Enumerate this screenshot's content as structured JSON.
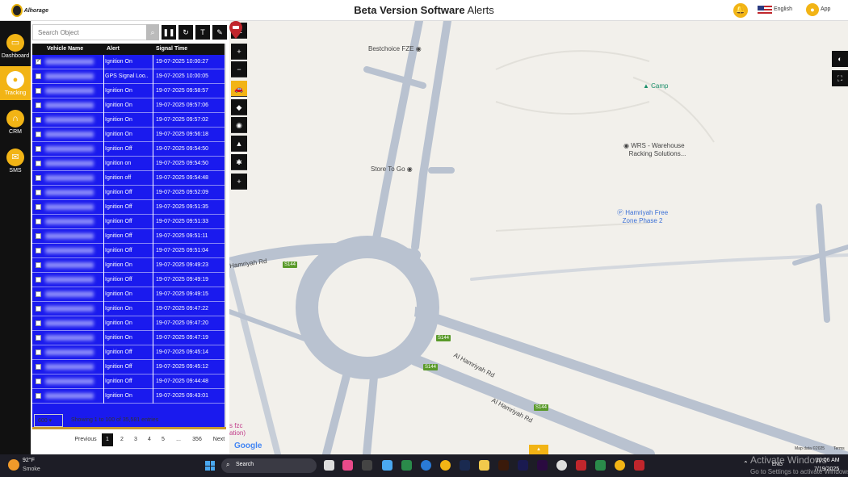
{
  "header": {
    "logo_text": "Alhorage",
    "title_bold": "Beta Version Software",
    "title_rest": " Alerts",
    "language": "English",
    "user": "App"
  },
  "nav": [
    {
      "label": "Dashboard",
      "icon": "monitor-icon"
    },
    {
      "label": "Tracking",
      "icon": "location-pin-icon"
    },
    {
      "label": "CRM",
      "icon": "headset-icon"
    },
    {
      "label": "SMS",
      "icon": "envelope-icon"
    }
  ],
  "panel": {
    "search_placeholder": "Search Object",
    "columns": [
      "Vehicle Name",
      "Alert",
      "Signal Time"
    ],
    "rows": [
      {
        "alert": "Ignition On",
        "time": "19-07-2025 10:00:27",
        "checked": true
      },
      {
        "alert": "GPS Signal Loo..",
        "time": "19-07-2025 10:00:05",
        "checked": false
      },
      {
        "alert": "Ignition On",
        "time": "19-07-2025 09:58:57",
        "checked": false
      },
      {
        "alert": "Ignition On",
        "time": "19-07-2025 09:57:06",
        "checked": false
      },
      {
        "alert": "Ignition On",
        "time": "19-07-2025 09:57:02",
        "checked": false
      },
      {
        "alert": "Ignition On",
        "time": "19-07-2025 09:56:18",
        "checked": false
      },
      {
        "alert": "Ignition Off",
        "time": "19-07-2025 09:54:50",
        "checked": false
      },
      {
        "alert": "Ignition on",
        "time": "19-07-2025 09:54:50",
        "checked": false
      },
      {
        "alert": "Ignition off",
        "time": "19-07-2025 09:54:48",
        "checked": false
      },
      {
        "alert": "Ignition Off",
        "time": "19-07-2025 09:52:09",
        "checked": false
      },
      {
        "alert": "Ignition Off",
        "time": "19-07-2025 09:51:35",
        "checked": false
      },
      {
        "alert": "Ignition Off",
        "time": "19-07-2025 09:51:33",
        "checked": false
      },
      {
        "alert": "Ignition Off",
        "time": "19-07-2025 09:51:11",
        "checked": false
      },
      {
        "alert": "Ignition Off",
        "time": "19-07-2025 09:51:04",
        "checked": false
      },
      {
        "alert": "Ignition On",
        "time": "19-07-2025 09:49:23",
        "checked": false
      },
      {
        "alert": "Ignition Off",
        "time": "19-07-2025 09:49:19",
        "checked": false
      },
      {
        "alert": "Ignition On",
        "time": "19-07-2025 09:49:15",
        "checked": false
      },
      {
        "alert": "Ignition On",
        "time": "19-07-2025 09:47:22",
        "checked": false
      },
      {
        "alert": "Ignition On",
        "time": "19-07-2025 09:47:20",
        "checked": false
      },
      {
        "alert": "Ignition On",
        "time": "19-07-2025 09:47:19",
        "checked": false
      },
      {
        "alert": "Ignition Off",
        "time": "19-07-2025 09:45:14",
        "checked": false
      },
      {
        "alert": "Ignition Off",
        "time": "19-07-2025 09:45:12",
        "checked": false
      },
      {
        "alert": "Ignition Off",
        "time": "19-07-2025 09:44:48",
        "checked": false
      },
      {
        "alert": "Ignition On",
        "time": "19-07-2025 09:43:01",
        "checked": false
      }
    ],
    "page_size": "600",
    "showing": "Showing 1 to 100 of 35,581 entries",
    "pagination": [
      "Previous",
      "1",
      "2",
      "3",
      "4",
      "5",
      "...",
      "356",
      "Next"
    ],
    "active_page": "1"
  },
  "map": {
    "pois": {
      "bestchoice": "Bestchoice FZE",
      "camp": "Camp",
      "wrs1": "WRS - Warehouse",
      "wrs2": "Racking Solutions...",
      "store": "Store To Go",
      "hamriyah1": "Hamriyah Free",
      "hamriyah2": "Zone Phase 2"
    },
    "roads": {
      "r1": "Hamriyah Rd",
      "r2": "Al Hamriyah Rd",
      "r3": "Al Hamriyah Rd"
    },
    "shield": "S144",
    "fzc_line1": "s fzc",
    "fzc_line2": "ation)",
    "google": "Google",
    "map_data": "Map data ©2025",
    "terms": "Terms"
  },
  "taskbar": {
    "temp": "92°F",
    "condition": "Smoke",
    "search": "Search",
    "lang": "ENG",
    "time": "10:06 AM",
    "date": "7/19/2025",
    "activate_title": "Activate Windows",
    "activate_sub": "Go to Settings to activate Windows."
  },
  "colors": {
    "accent": "#f2b415",
    "table_bg": "#1a1aee",
    "nav_bg": "#111111"
  }
}
